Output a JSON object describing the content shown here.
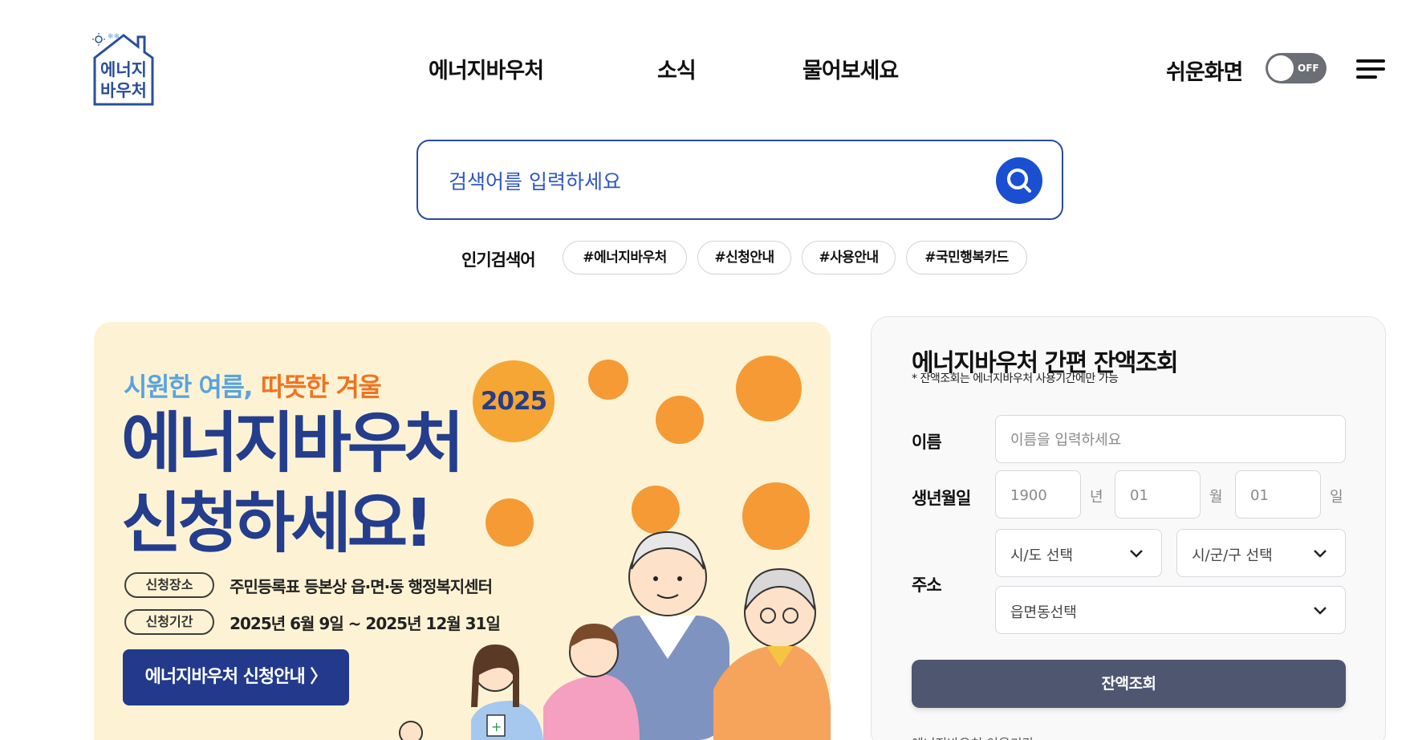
{
  "header": {
    "logo_text": [
      "에너지",
      "바우처"
    ],
    "nav": [
      {
        "label": "에너지바우처"
      },
      {
        "label": "소식"
      },
      {
        "label": "물어보세요"
      }
    ],
    "easy_screen_label": "쉬운화면",
    "toggle_state": "OFF"
  },
  "search": {
    "placeholder": "검색어를 입력하세요"
  },
  "popular": {
    "label": "인기검색어",
    "tags": [
      "#에너지바우처",
      "#신청안내",
      "#사용안내",
      "#국민행복카드"
    ]
  },
  "banner": {
    "slogan_cool": "시원한 여름,",
    "slogan_warm": "따뜻한 겨울",
    "year": "2025",
    "title_line1": "에너지바우처",
    "title_line2": "신청하세요!",
    "place_label": "신청장소",
    "place_value": "주민등록표 등본상 읍·면·동 행정복지센터",
    "period_label": "신청기간",
    "period_value": "2025년 6월 9일 ~ 2025년 12월 31일",
    "button_label": "에너지바우처 신청안내 〉"
  },
  "balance": {
    "title": "에너지바우처 간편 잔액조회",
    "note": "* 잔액조회는 에너지바우처 사용기간에만 가능",
    "name_label": "이름",
    "name_placeholder": "이름을 입력하세요",
    "birth_label": "생년월일",
    "year_placeholder": "1900",
    "year_unit": "년",
    "month_placeholder": "01",
    "month_unit": "월",
    "day_placeholder": "01",
    "day_unit": "일",
    "address_label": "주소",
    "sido_select": "시/도 선택",
    "sigungu_select": "시/군/구 선택",
    "dong_select": "읍면동선택",
    "submit_label": "잔액조회",
    "more_text": "에너지바우처 이용기간"
  },
  "colors": {
    "brand_blue": "#1b4fd1",
    "banner_navy": "#233a8c",
    "banner_bg": "#fdf3d4",
    "accent_orange": "#f59a35",
    "submit_gray": "#4e5670"
  }
}
